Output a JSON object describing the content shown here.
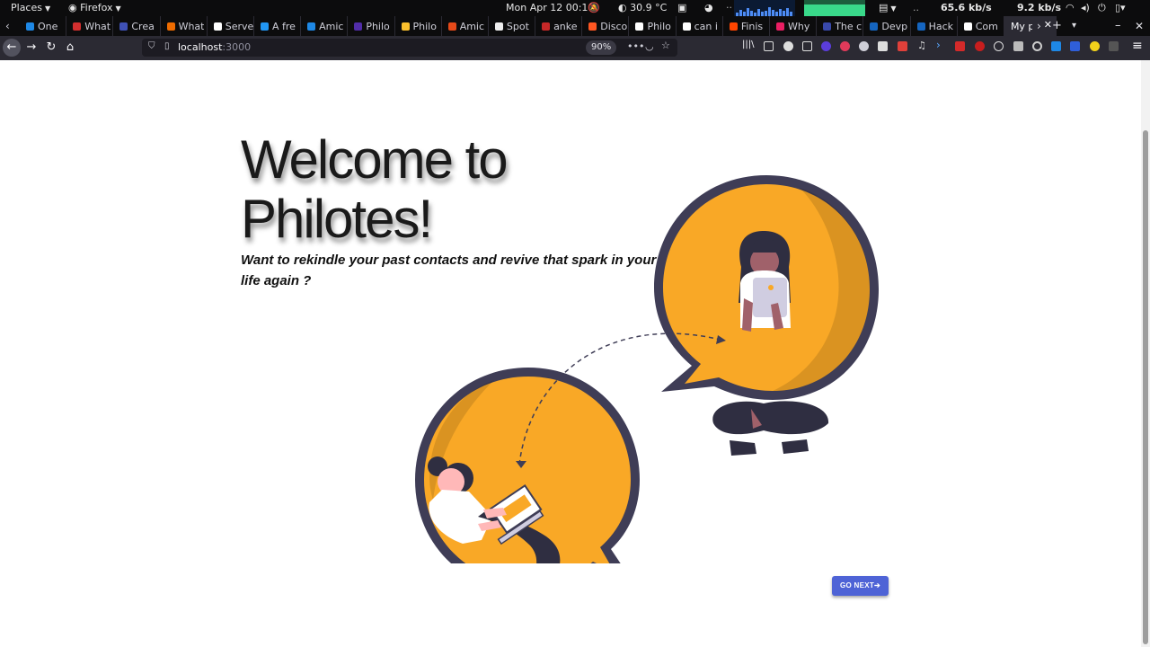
{
  "topbar": {
    "places": "Places",
    "firefox": "Firefox",
    "clock": "Mon Apr 12  00:10",
    "temperature": "30.9 °C",
    "dots": "..",
    "download": "65.6 kb/s",
    "upload": "9.2 kb/s"
  },
  "tabs": [
    {
      "title": "One"
    },
    {
      "title": "What"
    },
    {
      "title": "Crea"
    },
    {
      "title": "What"
    },
    {
      "title": "Serve"
    },
    {
      "title": "A fre"
    },
    {
      "title": "Amic"
    },
    {
      "title": "Philo"
    },
    {
      "title": "Philo"
    },
    {
      "title": "Amic"
    },
    {
      "title": "Spot"
    },
    {
      "title": "anke"
    },
    {
      "title": "Disco"
    },
    {
      "title": "Philo"
    },
    {
      "title": "can i"
    },
    {
      "title": "Finis"
    },
    {
      "title": "Why"
    },
    {
      "title": "The c"
    },
    {
      "title": "Devp"
    },
    {
      "title": "Hack"
    },
    {
      "title": "Com"
    },
    {
      "title": "My pa"
    }
  ],
  "nav": {
    "url_host": "localhost",
    "url_port": ":3000",
    "zoom": "90%",
    "more": "•••"
  },
  "page": {
    "title_line1": "Welcome to",
    "title_line2": "Philotes!",
    "tagline": "Want to rekindle your past contacts and revive that spark in your social life again ?",
    "go_next": "GO NEXT"
  }
}
